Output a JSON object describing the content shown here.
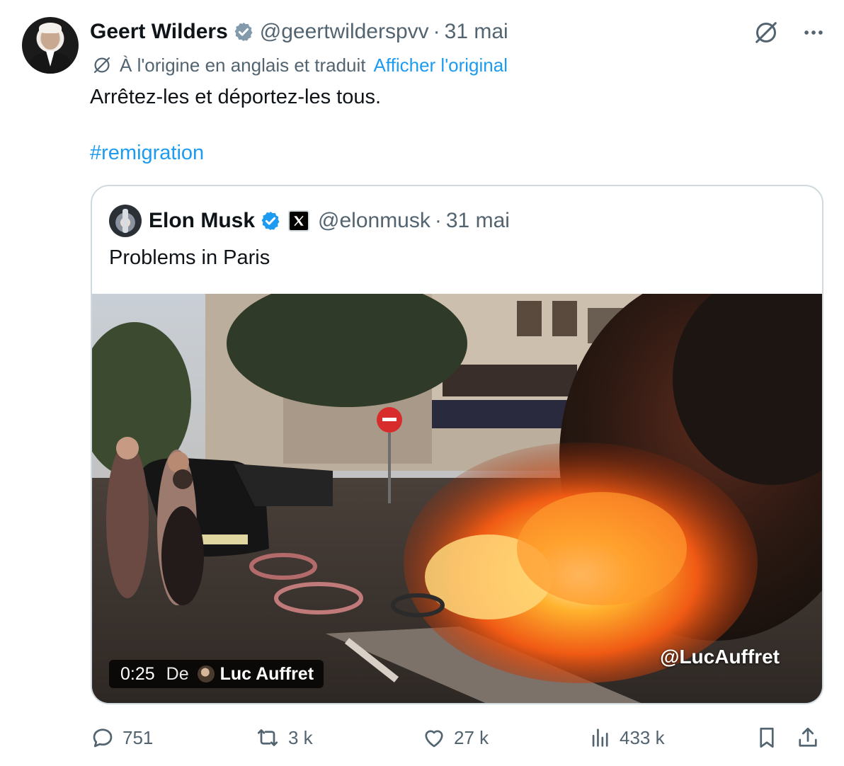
{
  "author": {
    "name": "Geert Wilders",
    "handle": "@geertwilderspvv",
    "separator": "·",
    "date": "31 mai"
  },
  "translation": {
    "label": "À l'origine en anglais et traduit",
    "link": "Afficher l'original"
  },
  "tweet": {
    "text": "Arrêtez-les et déportez-les tous.",
    "hashtag": "#remigration"
  },
  "quote": {
    "name": "Elon Musk",
    "handle": "@elonmusk",
    "separator": "·",
    "date": "31 mai",
    "text": "Problems in Paris",
    "video": {
      "duration": "0:25",
      "from_label": "De",
      "from_name": "Luc Auffret",
      "watermark": "@LucAuffret"
    }
  },
  "actions": {
    "replies": "751",
    "reposts": "3 k",
    "likes": "27 k",
    "views": "433 k"
  },
  "colors": {
    "accent": "#1d9bf0",
    "secondary_text": "#536471",
    "border": "#cfd9de"
  },
  "icons": {
    "verified": "verified-badge-icon",
    "grok": "slashed-circle-icon",
    "more": "more-dots-icon",
    "reply": "speech-bubble-icon",
    "repost": "repost-arrows-icon",
    "like": "heart-icon",
    "views": "bar-chart-icon",
    "bookmark": "bookmark-icon",
    "share": "share-upload-icon"
  }
}
